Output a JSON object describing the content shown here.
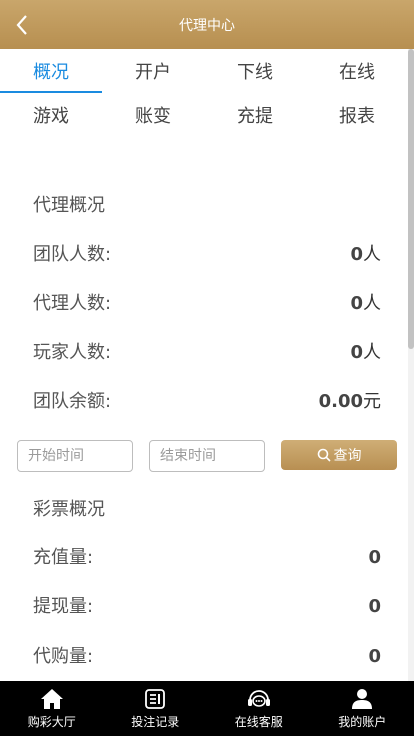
{
  "header": {
    "title": "代理中心"
  },
  "tabs": {
    "row1": [
      {
        "label": "概况",
        "active": true
      },
      {
        "label": "开户"
      },
      {
        "label": "下线"
      },
      {
        "label": "在线"
      }
    ],
    "row2": [
      {
        "label": "游戏"
      },
      {
        "label": "账变"
      },
      {
        "label": "充提"
      },
      {
        "label": "报表"
      }
    ]
  },
  "agent_overview": {
    "title": "代理概况",
    "team_members": {
      "label": "团队人数:",
      "value": "0",
      "unit": "人"
    },
    "agent_members": {
      "label": "代理人数:",
      "value": "0",
      "unit": "人"
    },
    "player_members": {
      "label": "玩家人数:",
      "value": "0",
      "unit": "人"
    },
    "team_balance": {
      "label": "团队余额:",
      "value": "0.00",
      "unit": "元"
    }
  },
  "filter": {
    "start_placeholder": "开始时间",
    "end_placeholder": "结束时间",
    "query_label": "查询"
  },
  "lottery_overview": {
    "title": "彩票概况",
    "recharge": {
      "label": "充值量:",
      "value": "0"
    },
    "withdraw": {
      "label": "提现量:",
      "value": "0"
    },
    "purchase": {
      "label": "代购量:",
      "value": "0"
    }
  },
  "footer": [
    {
      "label": "购彩大厅",
      "icon": "home-icon"
    },
    {
      "label": "投注记录",
      "icon": "record-icon"
    },
    {
      "label": "在线客服",
      "icon": "headset-icon"
    },
    {
      "label": "我的账户",
      "icon": "user-icon"
    }
  ],
  "colors": {
    "accent": "#1a8be0",
    "gold": "#c19a5b",
    "footer_bg": "#000000"
  }
}
